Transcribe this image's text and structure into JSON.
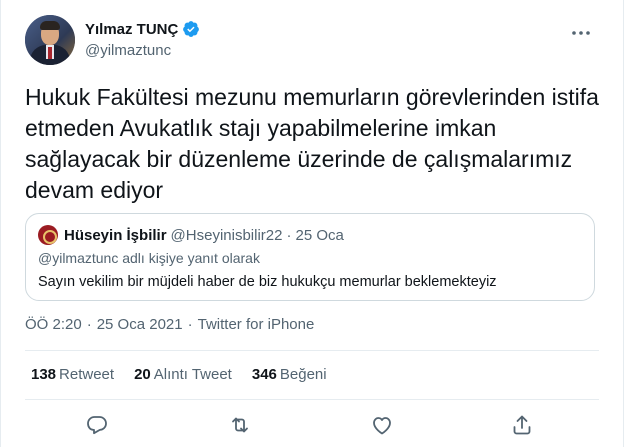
{
  "author": {
    "display_name": "Yılmaz TUNÇ",
    "handle": "@yilmaztunc",
    "verified": true,
    "avatar_icon": "profile-photo"
  },
  "tweet": {
    "text": "Hukuk Fakültesi mezunu memurların görevlerinden istifa etmeden Avukatlık stajı yapabilmelerine imkan sağlayacak bir düzenleme üzerinde de çalışmalarımız devam ediyor"
  },
  "quoted_tweet": {
    "display_name": "Hüseyin İşbilir",
    "handle": "@Hseyinisbilir22",
    "separator": "·",
    "date": "25 Oca",
    "reply_context": "@yilmaztunc adlı kişiye yanıt olarak",
    "text": "Sayın vekilim bir müjdeli haber de biz hukukçu memurlar beklemekteyiz"
  },
  "meta": {
    "time": "ÖÖ 2:20",
    "separator": "·",
    "date": "25 Oca 2021",
    "source": "Twitter for iPhone"
  },
  "stats": {
    "retweets_count": "138",
    "retweets_label": "Retweet",
    "quotes_count": "20",
    "quotes_label": "Alıntı Tweet",
    "likes_count": "346",
    "likes_label": "Beğeni"
  },
  "colors": {
    "accent": "#1d9bf0",
    "text": "#0f1419",
    "secondary": "#536471",
    "border": "#cfd9de"
  },
  "icons": [
    "verified-badge-icon",
    "more-options-icon",
    "reply-icon",
    "retweet-icon",
    "like-icon",
    "share-icon"
  ]
}
